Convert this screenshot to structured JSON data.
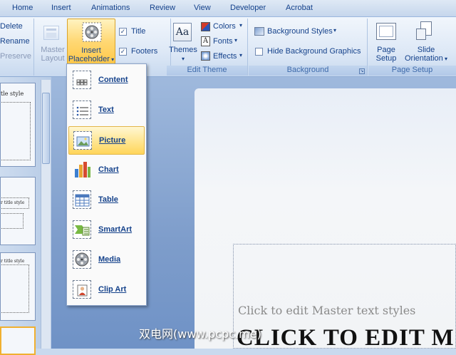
{
  "tabs": [
    "Home",
    "Insert",
    "Animations",
    "Review",
    "View",
    "Developer",
    "Acrobat"
  ],
  "ribbon": {
    "edit_master": {
      "delete": "Delete",
      "rename": "Rename",
      "preserve": "Preserve"
    },
    "master_layout": {
      "line1": "Master",
      "line2": "Layout"
    },
    "insert_placeholder": {
      "line1": "Insert",
      "line2": "Placeholder"
    },
    "checkboxes": [
      {
        "label": "Title",
        "checked": true
      },
      {
        "label": "Footers",
        "checked": true
      }
    ],
    "themes": {
      "label": "Themes",
      "glyph": "Aa"
    },
    "theme_options": {
      "colors": "Colors",
      "fonts": "Fonts",
      "effects": "Effects"
    },
    "group_edit_theme": "Edit Theme",
    "background_styles": "Background Styles",
    "hide_background": "Hide Background Graphics",
    "group_background": "Background",
    "page_setup": {
      "line1": "Page",
      "line2": "Setup"
    },
    "slide_orientation": {
      "line1": "Slide",
      "line2": "Orientation"
    },
    "group_page_setup": "Page Setup"
  },
  "thumbnails": [
    {
      "text": "tle style"
    },
    {
      "text": "r title style"
    },
    {
      "text": "r title style"
    }
  ],
  "dropdown": {
    "items": [
      {
        "label": "Content",
        "icon": "content-icon"
      },
      {
        "label": "Text",
        "icon": "text-icon"
      },
      {
        "label": "Picture",
        "icon": "picture-icon",
        "selected": true
      },
      {
        "label": "Chart",
        "icon": "chart-icon"
      },
      {
        "label": "Table",
        "icon": "table-icon"
      },
      {
        "label": "SmartArt",
        "icon": "smartart-icon"
      },
      {
        "label": "Media",
        "icon": "media-icon"
      },
      {
        "label": "Clip Art",
        "icon": "clip-art-icon"
      }
    ]
  },
  "slide": {
    "body_text": "Click to edit Master text styles",
    "title_text": "CLICK TO EDIT M"
  },
  "watermark": "双电网(www.pcpc.me)"
}
